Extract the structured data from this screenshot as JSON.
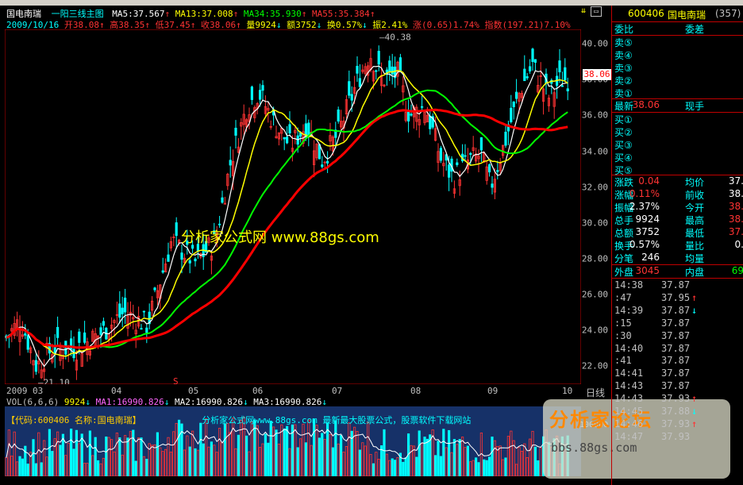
{
  "header": {
    "stock_name": "国电南瑞",
    "indicator_name": "一阳三线主图",
    "ma5": "MA5:37.567",
    "ma13": "MA13:37.008",
    "ma34": "MA34:35.930",
    "ma55": "MA55:35.384",
    "date": "2009/10/16",
    "open": "开38.08",
    "high": "高38.35",
    "low": "低37.45",
    "close": "收38.06",
    "volume": "量9924",
    "amount": "额3752",
    "turnover": "换0.57%",
    "amplitude": "振2.41%",
    "change": "涨(0.65)1.74%",
    "index": "指数(197.21)7.10%"
  },
  "watermark": "分析家公式网 www.88gs.com",
  "price_axis": [
    "40.00",
    "38.00",
    "36.00",
    "34.00",
    "32.00",
    "30.00",
    "28.00",
    "26.00",
    "24.00",
    "22.00"
  ],
  "price_marks": {
    "high": "40.38",
    "low": "21.10",
    "current": "38.06"
  },
  "months": [
    "2009",
    "03",
    "04",
    "05",
    "06",
    "07",
    "08",
    "09",
    "10"
  ],
  "timeframe_label": "日线",
  "s_marker": "S",
  "volume": {
    "title": "VOL(6,6,6)",
    "vol": "9924",
    "ma1": "MA1:16990.826",
    "ma2": "MA2:16990.826",
    "ma3": "MA3:16990.826",
    "axis_top": "100000"
  },
  "info_bar": {
    "code": "【代码:600406 名称:国电南瑞】",
    "slogan": "分析家公式网www.88gs.com 最新最大股票公式，股票软件下载网站"
  },
  "logo": {
    "text": "分析家论坛",
    "url": "bbs.88gs.com"
  },
  "right_panel": {
    "code": "600406",
    "name": "国电南瑞",
    "count": "(357)",
    "weibi": "委比",
    "weicha": "委差",
    "sells": [
      "卖⑤",
      "卖④",
      "卖③",
      "卖②",
      "卖①"
    ],
    "latest_label": "最新",
    "latest_value": "38.06",
    "current_hand": "现手",
    "buys": [
      "买①",
      "买②",
      "买③",
      "买④",
      "买⑤"
    ],
    "stats": [
      {
        "l1": "涨跌",
        "v1": "0.04",
        "c1": "#ff3333",
        "l2": "均价",
        "v2": "37."
      },
      {
        "l1": "涨幅",
        "v1": "0.11%",
        "c1": "#ff3333",
        "l2": "前收",
        "v2": "38."
      },
      {
        "l1": "振幅",
        "v1": "2.37%",
        "c1": "#ffffff",
        "l2": "今开",
        "v2": "38."
      },
      {
        "l1": "总手",
        "v1": "9924",
        "c1": "#ffffff",
        "l2": "最高",
        "v2": "38."
      },
      {
        "l1": "总额",
        "v1": "3752",
        "c1": "#ffffff",
        "l2": "最低",
        "v2": "37."
      },
      {
        "l1": "换手",
        "v1": "0.57%",
        "c1": "#ffffff",
        "l2": "量比",
        "v2": "0."
      },
      {
        "l1": "分笔",
        "v1": "246",
        "c1": "#ffffff",
        "l2": "均量",
        "v2": ""
      }
    ],
    "outer_label": "外盘",
    "outer_value": "3045",
    "inner_label": "内盘",
    "inner_value": "69",
    "ticks": [
      {
        "t": "14:38",
        "p": "37.87",
        "a": ""
      },
      {
        "t": ":47",
        "p": "37.95",
        "a": "↑"
      },
      {
        "t": "14:39",
        "p": "37.87",
        "a": "↓"
      },
      {
        "t": ":15",
        "p": "37.87",
        "a": ""
      },
      {
        "t": ":30",
        "p": "37.87",
        "a": ""
      },
      {
        "t": "14:40",
        "p": "37.87",
        "a": ""
      },
      {
        "t": ":41",
        "p": "37.87",
        "a": ""
      },
      {
        "t": "14:41",
        "p": "37.87",
        "a": ""
      },
      {
        "t": "14:43",
        "p": "37.87",
        "a": ""
      },
      {
        "t": "14:43",
        "p": "37.93",
        "a": "↑"
      },
      {
        "t": "14:45",
        "p": "37.88",
        "a": "↓"
      },
      {
        "t": "14:46",
        "p": "37.93",
        "a": "↑"
      },
      {
        "t": "14:47",
        "p": "37.93",
        "a": ""
      }
    ]
  },
  "colors": {
    "up": "#ff3333",
    "down": "#00ffff",
    "ma5": "#ffffff",
    "ma13": "#ffff00",
    "ma34": "#00ff00",
    "ma55": "#ff0000"
  }
}
